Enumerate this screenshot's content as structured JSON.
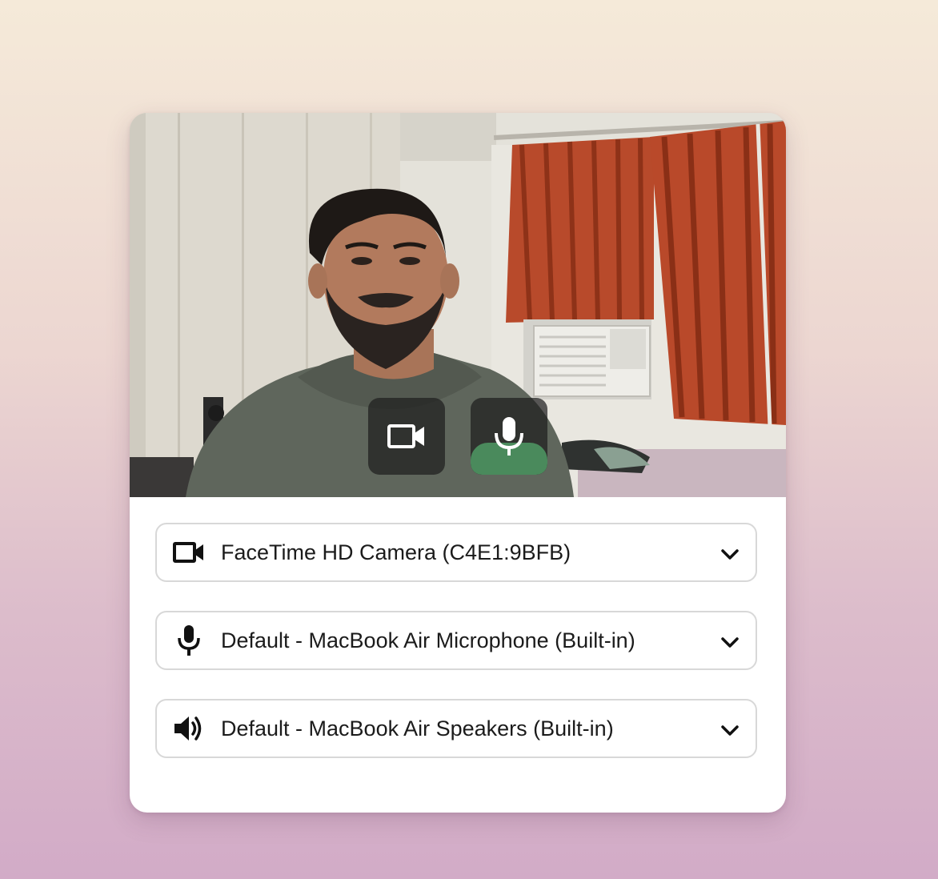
{
  "preview": {
    "camera_toggle_icon": "video-camera-icon",
    "mic_toggle_icon": "microphone-icon",
    "mic_active_color": "#4a8a5c",
    "mic_level": 0.42
  },
  "devices": {
    "camera": {
      "icon": "video-camera-icon",
      "selected": "FaceTime HD Camera (C4E1:9BFB)"
    },
    "microphone": {
      "icon": "microphone-icon",
      "selected": "Default - MacBook Air Microphone (Built-in)"
    },
    "speaker": {
      "icon": "speaker-icon",
      "selected": "Default - MacBook Air Speakers (Built-in)"
    }
  }
}
